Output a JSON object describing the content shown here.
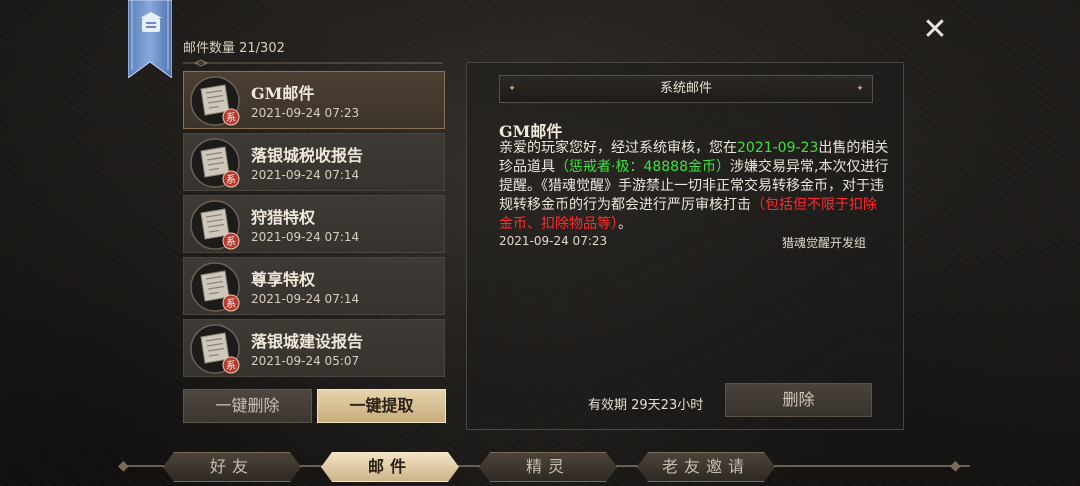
{
  "header": {
    "mail_count_label": "邮件数量 21/302",
    "close_icon": "close-icon"
  },
  "mail_list": [
    {
      "title": "GM邮件",
      "date": "2021-09-24 07:23",
      "badge": "系",
      "selected": true
    },
    {
      "title": "落银城税收报告",
      "date": "2021-09-24 07:14",
      "badge": "系",
      "selected": false
    },
    {
      "title": "狩猎特权",
      "date": "2021-09-24 07:14",
      "badge": "系",
      "selected": false
    },
    {
      "title": "尊享特权",
      "date": "2021-09-24 07:14",
      "badge": "系",
      "selected": false
    },
    {
      "title": "落银城建设报告",
      "date": "2021-09-24 05:07",
      "badge": "系",
      "selected": false
    }
  ],
  "list_actions": {
    "delete_all": "一键删除",
    "claim_all": "一键提取"
  },
  "detail": {
    "header": "系统邮件",
    "title": "GM邮件",
    "body_parts": {
      "p1": "亲爱的玩家您好，经过系统审核，您在",
      "date_highlight": "2021-09-23",
      "p2": "出售的相关珍品道具",
      "item_highlight": "（惩戒者·极：48888金币）",
      "p3": "涉嫌交易异常,本次仅进行提醒。《猎魂觉醒》手游禁止一切非正常交易转移金币，对于违规转移金币的行为都会进行严厉审核打击",
      "warn_highlight": "（包括但不限于扣除金币、扣除物品等）",
      "p4": "。"
    },
    "date": "2021-09-24 07:23",
    "sender": "猎魂觉醒开发组",
    "expiry": "有效期 29天23小时",
    "delete_button": "删除"
  },
  "tabs": [
    {
      "label": "好友",
      "active": false
    },
    {
      "label": "邮件",
      "active": true
    },
    {
      "label": "精灵",
      "active": false
    },
    {
      "label": "老友邀请",
      "active": false
    }
  ],
  "colors": {
    "highlight_green": "#3fe23a",
    "highlight_red": "#ff2b2b",
    "gold_button": "#d8c196"
  }
}
